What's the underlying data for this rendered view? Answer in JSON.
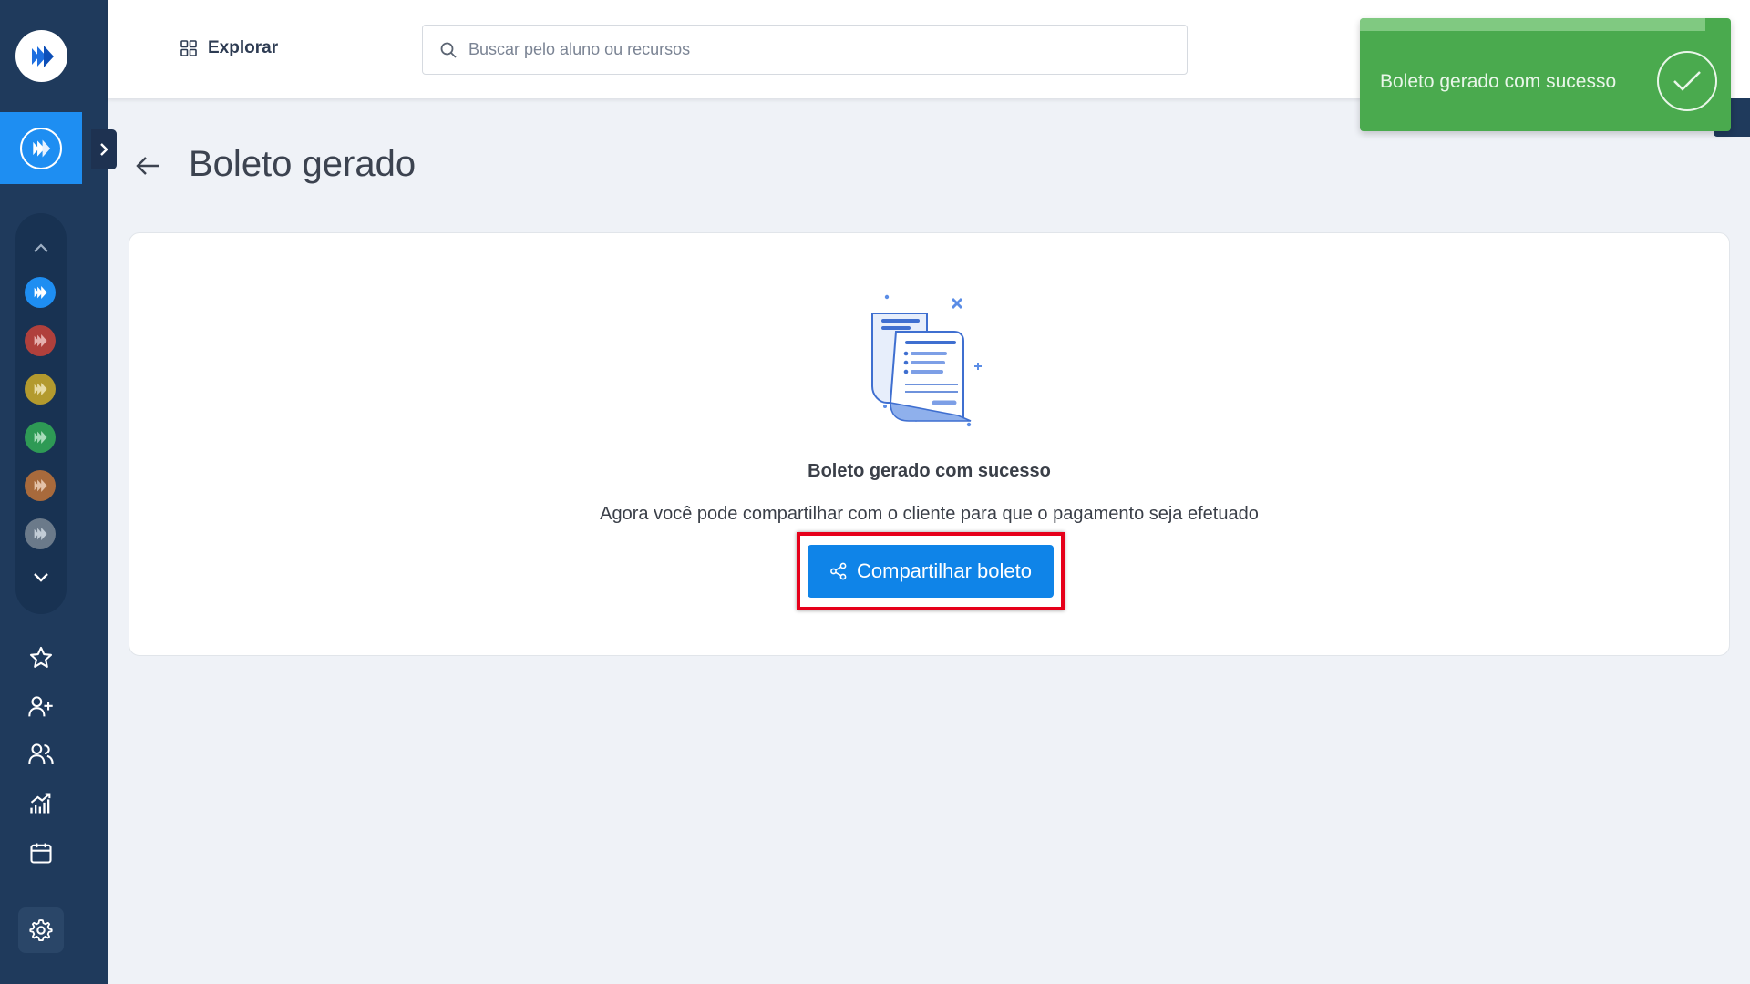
{
  "header": {
    "explore_label": "Explorar",
    "search_placeholder": "Buscar pelo aluno ou recursos"
  },
  "page": {
    "title": "Boleto gerado"
  },
  "card": {
    "success_title": "Boleto gerado com sucesso",
    "success_description": "Agora você pode compartilhar com o cliente para que o pagamento seja efetuado",
    "share_button_label": "Compartilhar boleto"
  },
  "toast": {
    "message": "Boleto gerado com sucesso",
    "progress_fraction": 0.93
  },
  "sidebar": {
    "units": [
      {
        "name": "unit-1",
        "color": "#1e8ef2"
      },
      {
        "name": "unit-2",
        "color": "#b0403c"
      },
      {
        "name": "unit-3",
        "color": "#b39a2e"
      },
      {
        "name": "unit-4",
        "color": "#2e9a55"
      },
      {
        "name": "unit-5",
        "color": "#a86a3c"
      },
      {
        "name": "unit-6",
        "color": "#6b7a8a"
      }
    ],
    "nav": [
      "star-icon",
      "add-user-icon",
      "users-icon",
      "chart-icon",
      "calendar-icon",
      "settings-icon"
    ]
  },
  "colors": {
    "sidebar": "#1f3a5c",
    "accent": "#1e8ef2",
    "toast": "#4aaa4e",
    "button": "#0f84e8",
    "highlight": "#e6001a"
  }
}
